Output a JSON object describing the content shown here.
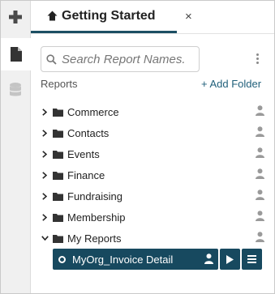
{
  "tab": {
    "title": "Getting Started",
    "close_glyph": "×"
  },
  "search": {
    "placeholder": "Search Report Names."
  },
  "reports_label": "Reports",
  "add_folder_label": "+ Add Folder",
  "folders": [
    {
      "label": "Commerce",
      "expanded": false
    },
    {
      "label": "Contacts",
      "expanded": false
    },
    {
      "label": "Events",
      "expanded": false
    },
    {
      "label": "Finance",
      "expanded": false
    },
    {
      "label": "Fundraising",
      "expanded": false
    },
    {
      "label": "Membership",
      "expanded": false
    },
    {
      "label": "My Reports",
      "expanded": true
    }
  ],
  "selected_report": {
    "label": "MyOrg_Invoice Detail"
  },
  "icons": {
    "rail": [
      "plus-icon",
      "document-icon",
      "database-icon"
    ],
    "tab": [
      "home-icon",
      "close-icon"
    ],
    "row": [
      "chevron-right-icon",
      "chevron-down-icon",
      "folder-icon",
      "user-icon"
    ],
    "report": [
      "user-icon",
      "play-icon",
      "menu-icon"
    ]
  },
  "colors": {
    "accent": "#17495f",
    "link": "#1f5f7a"
  }
}
